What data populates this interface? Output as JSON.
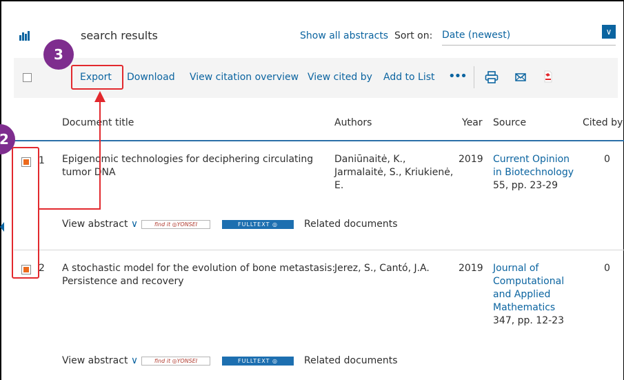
{
  "header": {
    "title": "search results",
    "show_all_abstracts": "Show all abstracts",
    "sort_label": "Sort on:",
    "sort_value": "Date (newest)"
  },
  "toolbar": {
    "export": "Export",
    "download": "Download",
    "view_citation_overview": "View citation overview",
    "view_cited_by": "View cited by",
    "add_to_list": "Add to List",
    "more": "•••"
  },
  "table": {
    "columns": [
      "Document title",
      "Authors",
      "Year",
      "Source",
      "Cited by"
    ],
    "rows": [
      {
        "num": "1",
        "title_lines": [
          "Epigenomic technologies for deciphering circulating",
          "tumor DNA"
        ],
        "author_lines": [
          "Daniūnaitė, K.,",
          "Jarmalaitė, S., Kriukienė,",
          "E."
        ],
        "year": "2019",
        "source_lines": [
          "Current Opinion",
          "in Biotechnology"
        ],
        "source_pages": "55, pp. 23-29",
        "cited_by": "0",
        "checked": true
      },
      {
        "num": "2",
        "title_lines": [
          "A stochastic model for the evolution of bone metastasis:",
          "Persistence and recovery"
        ],
        "author_lines": [
          "Jerez, S., Cantó, J.A."
        ],
        "year": "2019",
        "source_lines": [
          "Journal of",
          "Computational",
          "and Applied",
          "Mathematics"
        ],
        "source_pages": "347, pp. 12-23",
        "cited_by": "0",
        "checked": true
      }
    ],
    "view_abstract": "View abstract",
    "related_documents": "Related documents",
    "find_it_badge": "find it ◎YONSEI",
    "fulltext_badge": "FULLTEXT ◎"
  },
  "annotations": {
    "step3": "3",
    "step2": "2"
  },
  "colors": {
    "link": "#0b64a0",
    "annotation_red": "#e2282d",
    "badge_purple": "#7e2d8e",
    "checkbox_orange": "#ec6a1d"
  }
}
